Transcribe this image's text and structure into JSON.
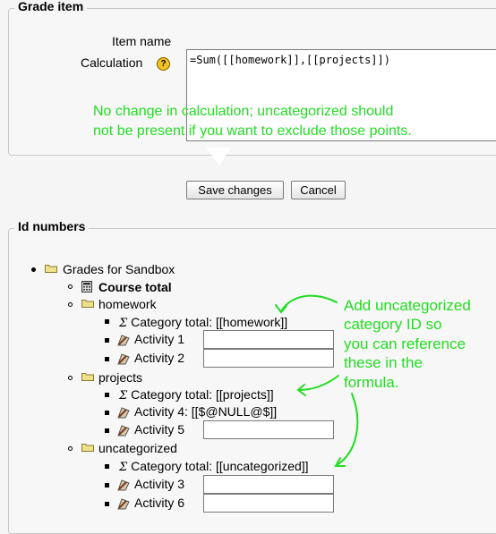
{
  "grade_item": {
    "legend": "Grade item",
    "item_name_label": "Item name",
    "calculation_label": "Calculation",
    "calculation_value": "=Sum([[homework]],[[projects]])",
    "help_glyph": "?"
  },
  "annotation_top": {
    "line1": "No change in calculation; uncategorized should",
    "line2": "not be present if you want to exclude those points."
  },
  "buttons": {
    "save": "Save changes",
    "cancel": "Cancel"
  },
  "id_numbers": {
    "legend": "Id numbers",
    "root": "Grades for Sandbox",
    "course_total": "Course total",
    "categories": [
      {
        "name": "homework",
        "total_label": "Category total: [[homework]]",
        "activities": [
          {
            "name": "Activity 1",
            "value": ""
          },
          {
            "name": "Activity 2",
            "value": ""
          }
        ]
      },
      {
        "name": "projects",
        "total_label": "Category total: [[projects]]",
        "activities": [
          {
            "name": "Activity 4: [[$@NULL@$]]",
            "value": null
          },
          {
            "name": "Activity 5",
            "value": ""
          }
        ]
      },
      {
        "name": "uncategorized",
        "total_label": "Category total: [[uncategorized]]",
        "activities": [
          {
            "name": "Activity 3",
            "value": ""
          },
          {
            "name": "Activity 6",
            "value": ""
          }
        ]
      }
    ]
  },
  "annotation_right": {
    "lines": [
      "Add uncategorized",
      "category ID so",
      "you can reference",
      "these in the",
      "formula."
    ]
  },
  "colors": {
    "annotation": "#22dd22",
    "folder": "#f0e08a",
    "help": "#f3c21b"
  },
  "icons": {
    "help": "help-icon",
    "folder": "folder-icon",
    "calculator": "calculator-icon",
    "sigma": "sigma-icon",
    "activity": "activity-icon"
  }
}
